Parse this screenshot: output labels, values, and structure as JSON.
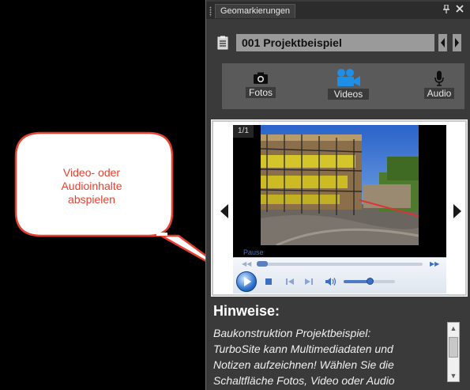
{
  "callout": {
    "line1": "Video- oder",
    "line2": "Audioinhalte",
    "line3": "abspielen",
    "color": "#e8402e"
  },
  "panel": {
    "title": "Geomarkierungen",
    "pin_icon": "pin-icon",
    "close_icon": "close-icon",
    "pin_glyph": "⎐",
    "close_glyph": "✕"
  },
  "project": {
    "name": "001 Projektbeispiel",
    "list_icon": "project-list-icon",
    "prev_icon": "triangle-left-icon",
    "next_icon": "triangle-right-icon"
  },
  "media_types": {
    "photos": {
      "label": "Fotos",
      "icon": "camera-icon"
    },
    "videos": {
      "label": "Videos",
      "icon": "video-camera-icon",
      "active": true,
      "accent": "#1e8fe6"
    },
    "audio": {
      "label": "Audio",
      "icon": "microphone-icon"
    }
  },
  "viewer": {
    "counter": "1/1",
    "status": "Pause",
    "media_position": 0.0,
    "volume": 0.5
  },
  "player": {
    "play_icon": "play-icon",
    "stop_icon": "stop-icon",
    "prev_icon": "skip-back-icon",
    "next_icon": "skip-forward-icon",
    "volume_icon": "speaker-icon",
    "seek_back_glyph": "◀◀",
    "seek_forward_glyph": "▶▶"
  },
  "hints": {
    "title": "Hinweise:",
    "line1": "Baukonstruktion Projektbeispiel:",
    "line2": "TurboSite kann Multimediadaten und",
    "line3": "Notizen aufzeichnen! Wählen Sie die",
    "line4": "Schaltfläche Fotos, Video oder Audio",
    "scroll_up_glyph": "▲",
    "scroll_down_glyph": "▼"
  }
}
